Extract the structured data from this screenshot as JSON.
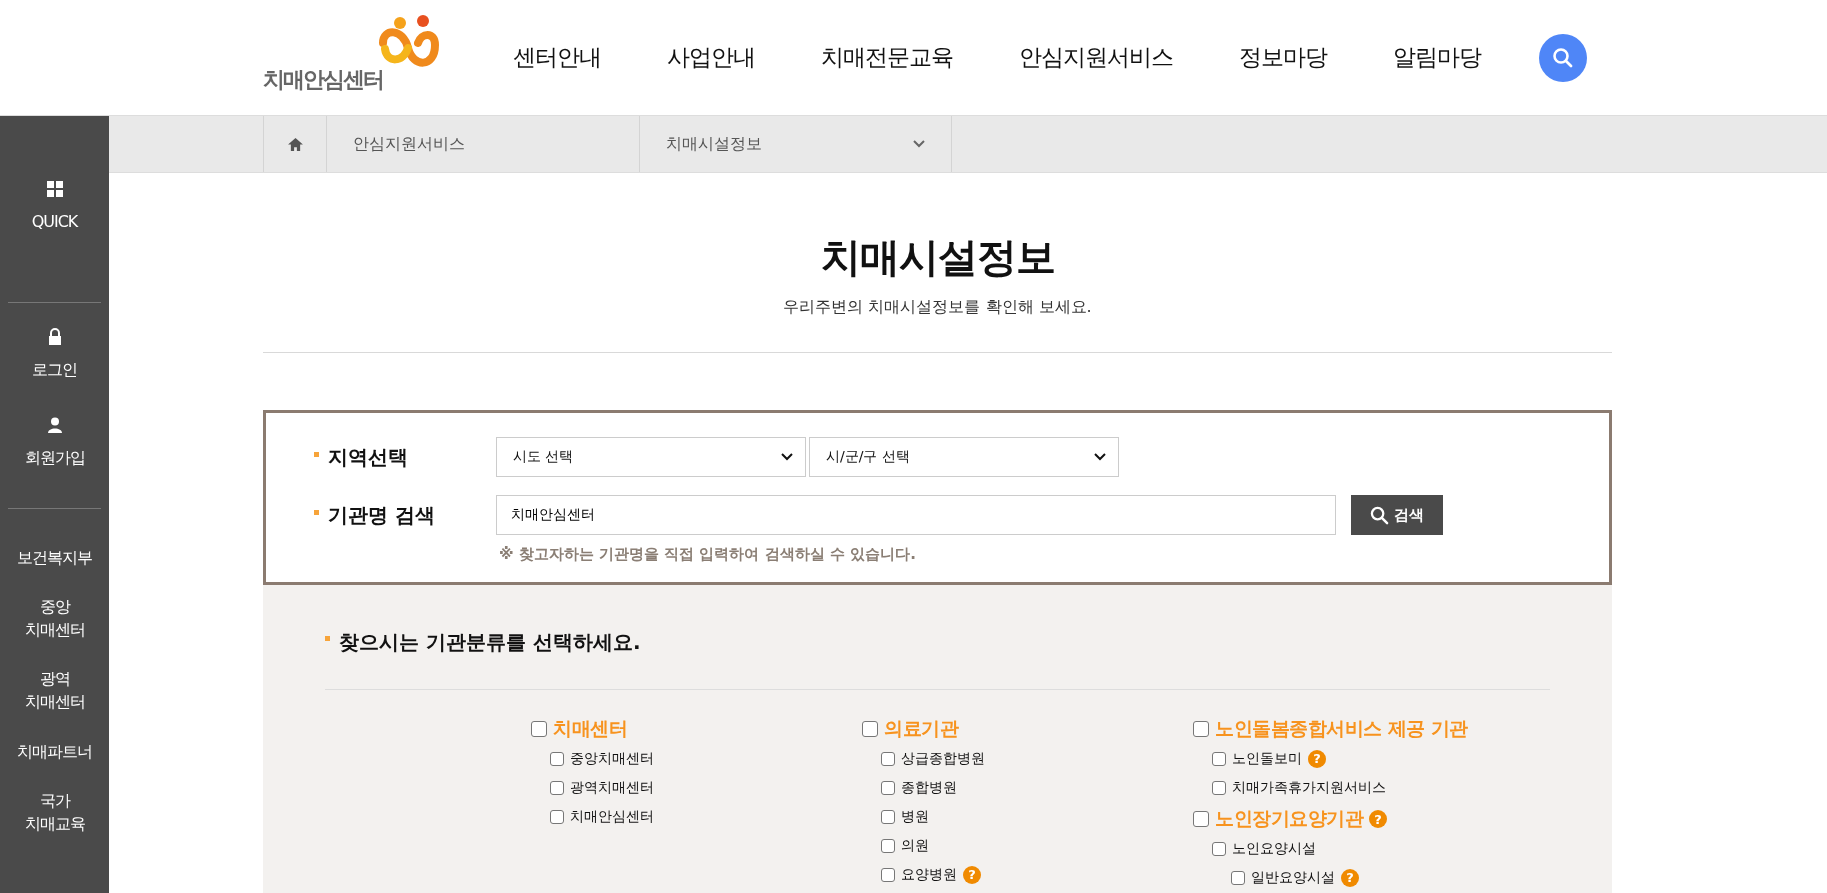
{
  "header": {
    "logo_text": "치매안심센터",
    "nav": [
      {
        "label": "센터안내"
      },
      {
        "label": "사업안내"
      },
      {
        "label": "치매전문교육"
      },
      {
        "label": "안심지원서비스"
      },
      {
        "label": "정보마당"
      },
      {
        "label": "알림마당"
      }
    ]
  },
  "sidebar": {
    "sections": [
      [
        {
          "label": "QUICK",
          "kind": "grid"
        }
      ],
      [
        {
          "label": "로그인",
          "kind": "lock"
        },
        {
          "label": "회원가입",
          "kind": "person"
        }
      ],
      [
        {
          "label": "보건복지부",
          "kind": "text"
        },
        {
          "label": "중앙\n치매센터",
          "kind": "text"
        },
        {
          "label": "광역\n치매센터",
          "kind": "text"
        },
        {
          "label": "치매파트너",
          "kind": "text"
        },
        {
          "label": "국가\n치매교육",
          "kind": "text"
        }
      ]
    ]
  },
  "breadcrumb": {
    "items": [
      {
        "label": "안심지원서비스",
        "dropdown": false
      },
      {
        "label": "치매시설정보",
        "dropdown": true
      }
    ]
  },
  "page": {
    "title": "치매시설정보",
    "subtitle": "우리주변의 치매시설정보를 확인해 보세요."
  },
  "search": {
    "region_label": "지역선택",
    "selects": [
      {
        "value": "시도 선택"
      },
      {
        "value": "시/군/구 선택"
      }
    ],
    "name_label": "기관명 검색",
    "name_value": "치매안심센터",
    "button": "검색",
    "hint": "※ 찾고자하는 기관명을 직접 입력하여 검색하실 수 있습니다."
  },
  "categories": {
    "heading": "찾으시는 기관분류를 선택하세요.",
    "columns": [
      [
        {
          "label": "치매센터",
          "checked": false,
          "children": [
            {
              "label": "중앙치매센터",
              "checked": false
            },
            {
              "label": "광역치매센터",
              "checked": false
            },
            {
              "label": "치매안심센터",
              "checked": false
            }
          ]
        }
      ],
      [
        {
          "label": "의료기관",
          "checked": false,
          "children": [
            {
              "label": "상급종합병원",
              "checked": false
            },
            {
              "label": "종합병원",
              "checked": false
            },
            {
              "label": "병원",
              "checked": false
            },
            {
              "label": "의원",
              "checked": false
            },
            {
              "label": "요양병원",
              "checked": false,
              "help": "?"
            }
          ]
        }
      ],
      [
        {
          "label": "노인돌봄종합서비스 제공 기관",
          "checked": false,
          "children": [
            {
              "label": "노인돌보미",
              "checked": false,
              "help": "?"
            },
            {
              "label": "치매가족휴가지원서비스",
              "checked": false
            }
          ]
        },
        {
          "label": "노인장기요양기관",
          "checked": false,
          "help": "?",
          "children": [
            {
              "label": "노인요양시설",
              "checked": false,
              "children": [
                {
                  "label": "일반요양시설",
                  "checked": false,
                  "help": "?"
                }
              ]
            }
          ]
        }
      ]
    ]
  }
}
